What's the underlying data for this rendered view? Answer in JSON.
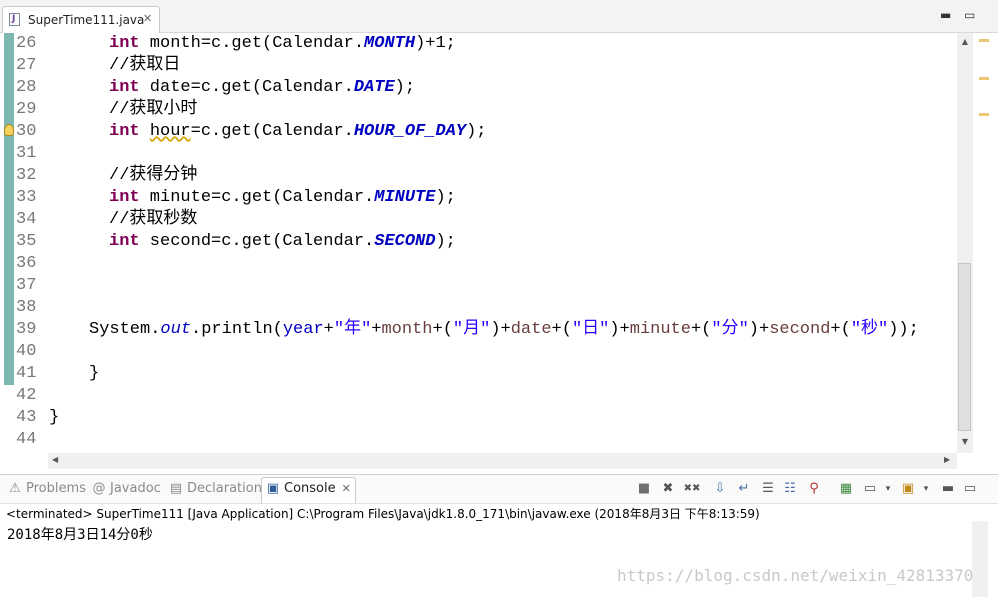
{
  "editor_tab": {
    "title": "SuperTime111.java",
    "close": "✕"
  },
  "window_controls": {
    "minimize": "▬",
    "maximize": "▭"
  },
  "gutter": {
    "line_numbers": [
      "26",
      "27",
      "28",
      "29",
      "30",
      "31",
      "32",
      "33",
      "34",
      "35",
      "36",
      "37",
      "38",
      "39",
      "40",
      "41",
      "42",
      "43",
      "44"
    ]
  },
  "code": {
    "l26": {
      "kw": "int",
      "a": " month=c.get(Calendar.",
      "f": "MONTH",
      "b": ")+1;"
    },
    "l27": {
      "comment": "//获取日"
    },
    "l28": {
      "kw": "int",
      "a": " date=c.get(Calendar.",
      "f": "DATE",
      "b": ");"
    },
    "l29": {
      "comment": "//获取小时"
    },
    "l30": {
      "kw": "int",
      "pre": " ",
      "warn": "hour",
      "a": "=c.get(Calendar.",
      "f": "HOUR_OF_DAY",
      "b": ");"
    },
    "l32": {
      "comment": "//获得分钟"
    },
    "l33": {
      "kw": "int",
      "a": " minute=c.get(Calendar.",
      "f": "MINUTE",
      "b": ");"
    },
    "l34": {
      "comment": "//获取秒数"
    },
    "l35": {
      "kw": "int",
      "a": " second=c.get(Calendar.",
      "f": "SECOND",
      "b": ");"
    },
    "l39": {
      "a": "System.",
      "out": "out",
      "b": ".println(",
      "v1": "year",
      "c": "+",
      "s1": "\"年\"",
      "d": "+",
      "v2": "month",
      "e": "+(",
      "s2": "\"月\"",
      "f2": ")+",
      "v3": "date",
      "g": "+(",
      "s3": "\"日\"",
      "h": ")+",
      "v4": "minute",
      "i": "+(",
      "s4": "\"分\"",
      "j": ")+",
      "v5": "second",
      "k": "+(",
      "s5": "\"秒\"",
      "l": "));"
    },
    "l41": {
      "text": "}"
    },
    "l43": {
      "text": "}"
    }
  },
  "bottom_tabs": [
    {
      "label": "Problems",
      "icon": "problems-icon",
      "glyph": "⚠"
    },
    {
      "label": "Javadoc",
      "icon": "javadoc-icon",
      "glyph": "@"
    },
    {
      "label": "Declaration",
      "icon": "declaration-icon",
      "glyph": "▤"
    },
    {
      "label": "Console",
      "icon": "console-icon",
      "glyph": "▣",
      "active": true
    }
  ],
  "console_tab_close": "✕",
  "console_toolbar": {
    "terminate": "■",
    "remove_launch": "✖",
    "remove_all": "✖✖",
    "scroll_lock": "⇩",
    "word_wrap": "↵",
    "pin": "⚲",
    "open_console": "▾"
  },
  "console": {
    "header": "<terminated> SuperTime111 [Java Application] C:\\Program Files\\Java\\jdk1.8.0_171\\bin\\javaw.exe (2018年8月3日 下午8:13:59)",
    "output": "2018年8月3日14分0秒"
  },
  "watermark": "https://blog.csdn.net/weixin_42813370",
  "colors": {
    "keyword": "#7f0055",
    "comment": "#3f7f5f",
    "string": "#2a00ff",
    "field": "#0000c0",
    "local_var": "#6a3e3e",
    "quick_diff": "#7eb6b2"
  }
}
